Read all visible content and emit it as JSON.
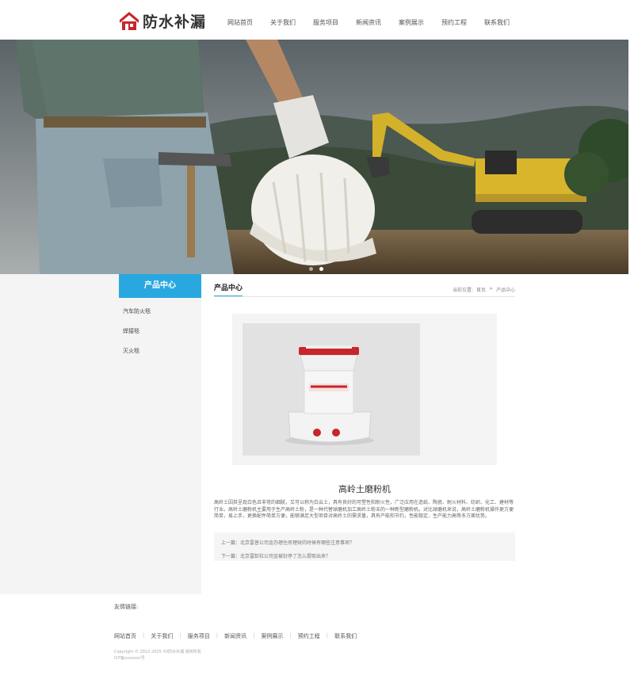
{
  "logo": {
    "text": "防水补漏"
  },
  "nav": [
    {
      "label": "网站首页"
    },
    {
      "label": "关于我们"
    },
    {
      "label": "服务项目"
    },
    {
      "label": "新闻资讯"
    },
    {
      "label": "案例展示"
    },
    {
      "label": "预约工程"
    },
    {
      "label": "联系我们"
    }
  ],
  "banner": {
    "slide_count": 2,
    "active_slide": 2
  },
  "sidebar": {
    "title": "产品中心",
    "items": [
      {
        "label": "汽车防火毯"
      },
      {
        "label": "焊接毯"
      },
      {
        "label": "灭火毯"
      }
    ]
  },
  "main": {
    "title": "产品中心",
    "breadcrumb": {
      "prefix": "当前位置:",
      "home": "首页",
      "sep": ">",
      "current": "产品中心"
    }
  },
  "product": {
    "name": "高岭土磨粉机",
    "description": "高岭土因其呈现白色且非常的细腻，又可以称为白云土，具有良好的可塑性和耐火性，广泛应用在造纸、陶瓷、耐火材料、纺织、化工、建材等行业。高岭土磨粉机主要用于生产高岭土粉，是一种代替球磨机加工高岭土粉末的一种新型磨粉机。对比球磨机来说，高岭土磨粉机操作更方便简单，易上手，更换配件简单方便，能够满足大型项目对高岭土的需求量，具有产能和节约，性能稳定，生产能力高等多方面优势。",
    "prev": "上一篇：北京雷普公司金办理住房理财的时候有哪些注意事项？",
    "next": "下一篇：北京雷卸拉公司金被封停了怎么提取出来？"
  },
  "footer": {
    "friend_links": "友情链接:",
    "nav": [
      {
        "label": "网站首页"
      },
      {
        "label": "关于我们"
      },
      {
        "label": "服务项目"
      },
      {
        "label": "新闻资讯"
      },
      {
        "label": "案例展示"
      },
      {
        "label": "预约工程"
      },
      {
        "label": "联系我们"
      }
    ],
    "copyright": "Copyright © 2012-2025 XX防水补漏 版权所有",
    "icp": "ICP备xxxxxxx号"
  },
  "colors": {
    "accent": "#29a8e0",
    "logo_red": "#c8262a"
  }
}
